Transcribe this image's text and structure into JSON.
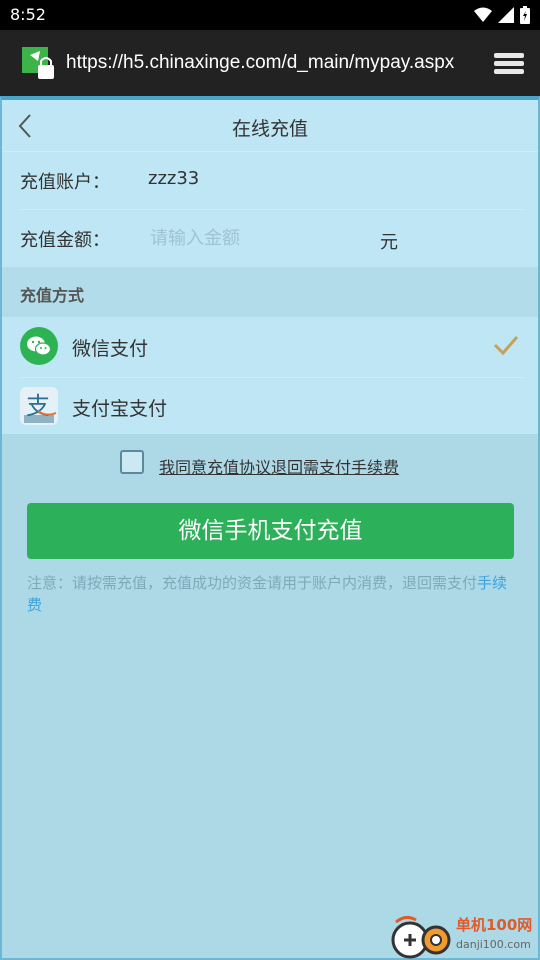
{
  "status_bar": {
    "time": "8:52",
    "icons": [
      "wifi-icon",
      "signal-icon",
      "battery-icon"
    ]
  },
  "browser": {
    "url": "https://h5.chinaxinge.com/d_main/mypay.aspx",
    "site_icon": "site-lock-icon",
    "menu_icon": "menu-icon"
  },
  "header": {
    "title": "在线充值",
    "back_icon": "back-chevron-icon"
  },
  "form": {
    "account_label": "充值账户：",
    "account_value": "zzz33",
    "amount_label": "充值金额：",
    "amount_placeholder": "请输入金额",
    "amount_value": "",
    "amount_unit": "元"
  },
  "payment": {
    "section_title": "充值方式",
    "methods": [
      {
        "label": "微信支付",
        "icon": "wechat-icon",
        "selected": true
      },
      {
        "label": "支付宝支付",
        "icon": "alipay-icon",
        "selected": false
      }
    ]
  },
  "agreement": {
    "text": "我同意充值协议退回需支付手续费",
    "checked": false
  },
  "pay_button": {
    "label": "微信手机支付充值"
  },
  "notice": {
    "text": "注意：请按需充值，充值成功的资金请用于账户内消费，退回需支付",
    "link": "手续费"
  },
  "watermark": {
    "cn": "单机100网",
    "en": "danji100.com"
  },
  "colors": {
    "page_bg": "#add8e6",
    "panel_bg": "#bee6f4",
    "button_green": "#2db05a",
    "wechat_green": "#2eb354",
    "link_blue": "#3aa3e0",
    "check_gold": "#c8a05a"
  }
}
